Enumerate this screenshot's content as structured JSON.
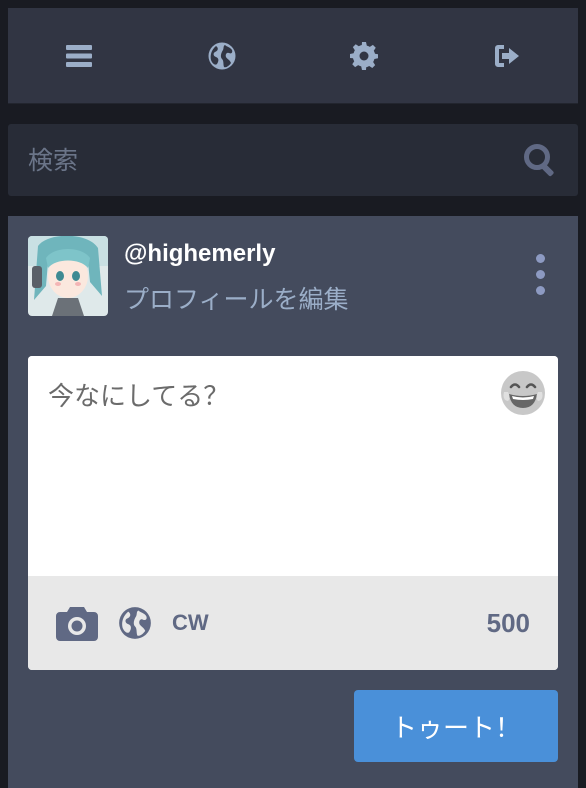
{
  "nav": {
    "icons": [
      "menu-icon",
      "globe-icon",
      "gear-icon",
      "sign-out-icon"
    ]
  },
  "search": {
    "placeholder": "検索",
    "icon": "search-icon"
  },
  "account": {
    "username": "@highemerly",
    "edit_profile": "プロフィールを編集"
  },
  "compose": {
    "placeholder": "今なにしてる？",
    "cw_label": "CW",
    "char_count": "500",
    "submit_label": "トゥート！"
  },
  "colors": {
    "accent": "#4a90d9",
    "nav_bg": "#313543",
    "compose_bg": "#444b5d",
    "icon": "#9baec8"
  }
}
